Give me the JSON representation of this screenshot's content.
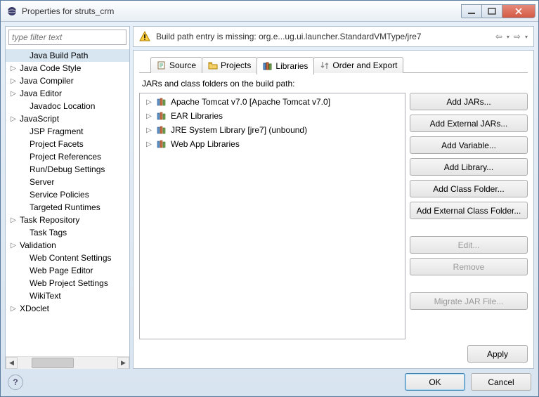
{
  "window": {
    "title": "Properties for struts_crm"
  },
  "filter": {
    "placeholder": "type filter text"
  },
  "navTree": [
    {
      "label": "Java Build Path",
      "expandable": false,
      "indent": 1,
      "selected": true
    },
    {
      "label": "Java Code Style",
      "expandable": true,
      "indent": 0
    },
    {
      "label": "Java Compiler",
      "expandable": true,
      "indent": 0
    },
    {
      "label": "Java Editor",
      "expandable": true,
      "indent": 0
    },
    {
      "label": "Javadoc Location",
      "expandable": false,
      "indent": 1
    },
    {
      "label": "JavaScript",
      "expandable": true,
      "indent": 0
    },
    {
      "label": "JSP Fragment",
      "expandable": false,
      "indent": 1
    },
    {
      "label": "Project Facets",
      "expandable": false,
      "indent": 1
    },
    {
      "label": "Project References",
      "expandable": false,
      "indent": 1
    },
    {
      "label": "Run/Debug Settings",
      "expandable": false,
      "indent": 1
    },
    {
      "label": "Server",
      "expandable": false,
      "indent": 1
    },
    {
      "label": "Service Policies",
      "expandable": false,
      "indent": 1
    },
    {
      "label": "Targeted Runtimes",
      "expandable": false,
      "indent": 1
    },
    {
      "label": "Task Repository",
      "expandable": true,
      "indent": 0
    },
    {
      "label": "Task Tags",
      "expandable": false,
      "indent": 1
    },
    {
      "label": "Validation",
      "expandable": true,
      "indent": 0
    },
    {
      "label": "Web Content Settings",
      "expandable": false,
      "indent": 1
    },
    {
      "label": "Web Page Editor",
      "expandable": false,
      "indent": 1
    },
    {
      "label": "Web Project Settings",
      "expandable": false,
      "indent": 1
    },
    {
      "label": "WikiText",
      "expandable": false,
      "indent": 1
    },
    {
      "label": "XDoclet",
      "expandable": true,
      "indent": 0
    }
  ],
  "banner": {
    "message": "Build path entry is missing: org.e...ug.ui.launcher.StandardVMType/jre7"
  },
  "tabs": [
    {
      "label": "Source",
      "active": false
    },
    {
      "label": "Projects",
      "active": false
    },
    {
      "label": "Libraries",
      "active": true
    },
    {
      "label": "Order and Export",
      "active": false
    }
  ],
  "description": "JARs and class folders on the build path:",
  "libraries": [
    {
      "label": "Apache Tomcat v7.0 [Apache Tomcat v7.0]"
    },
    {
      "label": "EAR Libraries"
    },
    {
      "label": "JRE System Library [jre7] (unbound)"
    },
    {
      "label": "Web App Libraries"
    }
  ],
  "buttons": {
    "addJars": "Add JARs...",
    "addExternalJars": "Add External JARs...",
    "addVariable": "Add Variable...",
    "addLibrary": "Add Library...",
    "addClassFolder": "Add Class Folder...",
    "addExternalClassFolder": "Add External Class Folder...",
    "edit": "Edit...",
    "remove": "Remove",
    "migrate": "Migrate JAR File...",
    "apply": "Apply",
    "ok": "OK",
    "cancel": "Cancel"
  }
}
